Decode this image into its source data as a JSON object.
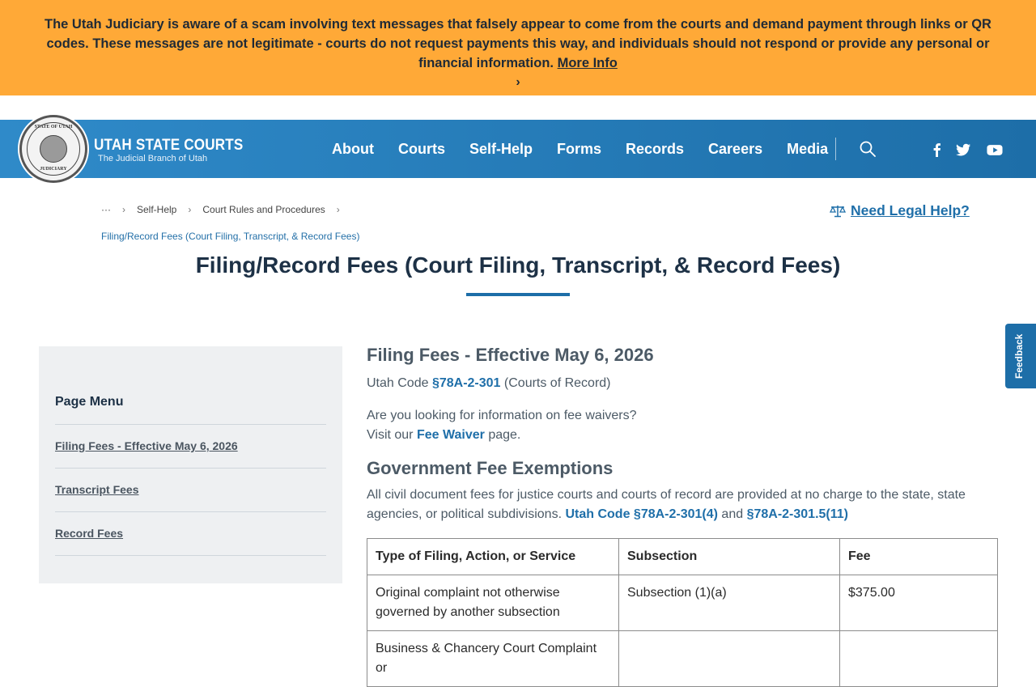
{
  "alert": {
    "text": "The Utah Judiciary is aware of a scam involving text messages that falsely appear to come from the courts and demand payment through links or QR codes. These messages are not legitimate - courts do not request payments this way, and individuals should not respond or provide any personal or financial information.",
    "link_label": "More Info",
    "chevron": "›"
  },
  "header": {
    "seal_top": "STATE OF UTAH",
    "seal_bottom": "JUDICIARY",
    "brand_title": "UTAH STATE COURTS",
    "brand_sub": "The Judicial Branch of Utah",
    "nav": [
      "About",
      "Courts",
      "Self-Help",
      "Forms",
      "Records",
      "Careers",
      "Media"
    ]
  },
  "breadcrumb": {
    "ellipsis": "···",
    "items": [
      "Self-Help",
      "Court Rules and Procedures"
    ],
    "separator": "›",
    "current": "Filing/Record Fees (Court Filing, Transcript, & Record Fees)"
  },
  "legal_help": "Need Legal Help?",
  "page_title": "Filing/Record Fees (Court Filing, Transcript, & Record Fees)",
  "sidebar": {
    "heading": "Page Menu",
    "items": [
      "Filing Fees - Effective May 6, 2026",
      "Transcript Fees",
      "Record Fees"
    ]
  },
  "main": {
    "heading": "Filing Fees - Effective May 6, 2026",
    "code_prefix": "Utah Code",
    "code_link": "§78A-2-301",
    "code_suffix": "(Courts of Record)",
    "waiver_q": "Are you looking for information on fee waivers?",
    "waiver_visit": "Visit our",
    "waiver_link": "Fee Waiver",
    "waiver_suffix": "page.",
    "gov_heading": "Government Fee Exemptions",
    "gov_text": "All civil document fees for justice courts and courts of record are provided at no charge to the state, state agencies, or political subdivisions.",
    "gov_link1": "Utah Code §78A-2-301(4)",
    "gov_and": "and",
    "gov_link2": "§78A-2-301.5(11)",
    "table": {
      "headers": [
        "Type of Filing, Action, or Service",
        "Subsection",
        "Fee"
      ],
      "rows": [
        [
          "Original complaint not otherwise governed by another subsection",
          "Subsection (1)(a)",
          "$375.00"
        ],
        [
          "Business & Chancery Court Complaint or",
          "",
          ""
        ]
      ]
    }
  },
  "feedback": "Feedback",
  "colors": {
    "alert_bg": "#ffa937",
    "header_blue": "#1d6ea8",
    "link_blue": "#1f6fa9"
  }
}
